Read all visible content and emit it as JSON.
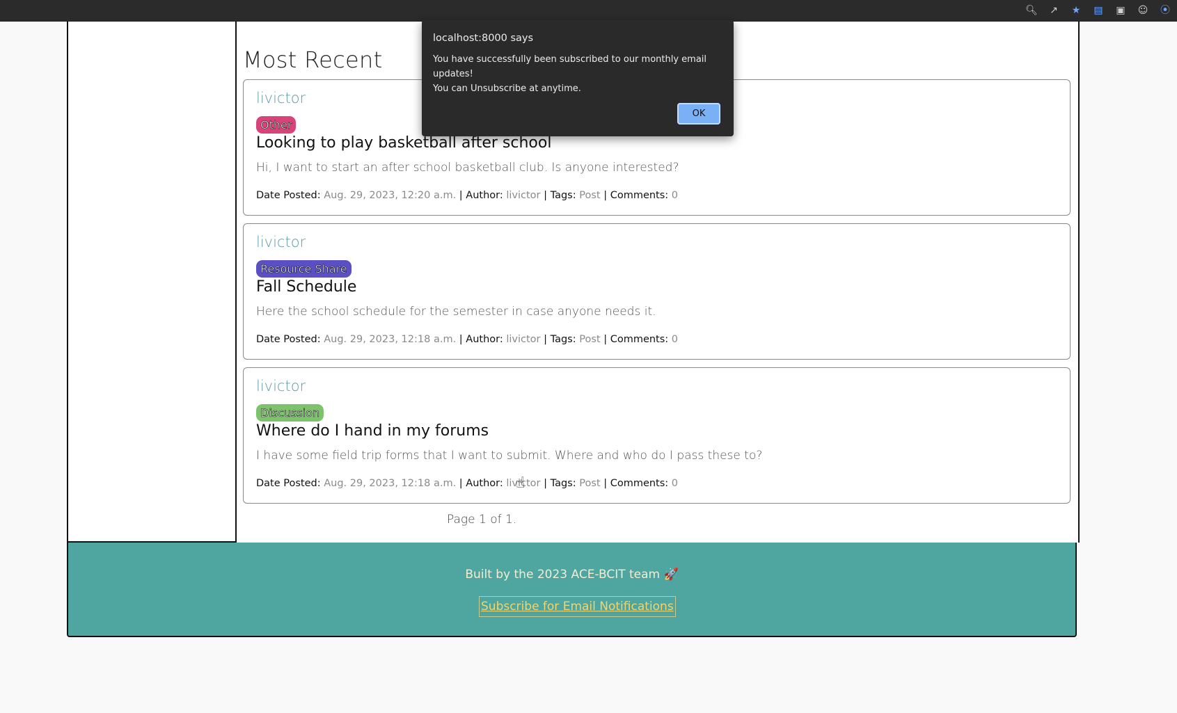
{
  "browser": {
    "icons": [
      "zoom-icon",
      "share-icon",
      "bookmark-star-icon",
      "extension-icon",
      "camera-icon",
      "profile-icon",
      "wifi-icon"
    ]
  },
  "main": {
    "section_title": "Most Recent",
    "posts": [
      {
        "author": "livictor",
        "tag": "Other",
        "tag_color": "#d9437a",
        "title": "Looking to play basketball after school",
        "excerpt": "Hi, I want to start an after school basketball club. Is anyone interested?",
        "meta": {
          "date_label": "Date Posted:",
          "date": "Aug. 29, 2023, 12:20 a.m.",
          "author_label": "Author:",
          "author": "livictor",
          "tags_label": "Tags:",
          "tags": "Post",
          "comments_label": "Comments:",
          "comments": "0"
        }
      },
      {
        "author": "livictor",
        "tag": "Resource Share",
        "tag_color": "#5a4fc3",
        "title": "Fall Schedule",
        "excerpt": "Here the school schedule for the semester in case anyone needs it.",
        "meta": {
          "date_label": "Date Posted:",
          "date": "Aug. 29, 2023, 12:18 a.m.",
          "author_label": "Author:",
          "author": "livictor",
          "tags_label": "Tags:",
          "tags": "Post",
          "comments_label": "Comments:",
          "comments": "0"
        }
      },
      {
        "author": "livictor",
        "tag": "Discussion",
        "tag_color": "#7dc36b",
        "title": "Where do I hand in my forums",
        "excerpt": "I have some field trip forms that I want to submit. Where and who do I pass these to?",
        "meta": {
          "date_label": "Date Posted:",
          "date": "Aug. 29, 2023, 12:18 a.m.",
          "author_label": "Author:",
          "author": "livictor",
          "tags_label": "Tags:",
          "tags": "Post",
          "comments_label": "Comments:",
          "comments": "0"
        }
      }
    ],
    "pagination": "Page 1 of 1."
  },
  "footer": {
    "built_by": "Built by the 2023 ACE-BCIT team 🚀",
    "subscribe_link": "Subscribe for Email Notifications"
  },
  "dialog": {
    "title": "localhost:8000 says",
    "message_line1": "You have successfully been subscribed to our monthly email updates!",
    "message_line2": "You can Unsubscribe at anytime.",
    "ok_label": "OK"
  },
  "colors": {
    "footer_bg": "#4fa5a0",
    "author_link": "#5a9aa6",
    "subscribe_link": "#f2d56b",
    "dialog_bg": "#2a2a2a",
    "ok_button": "#7ab0f6"
  }
}
